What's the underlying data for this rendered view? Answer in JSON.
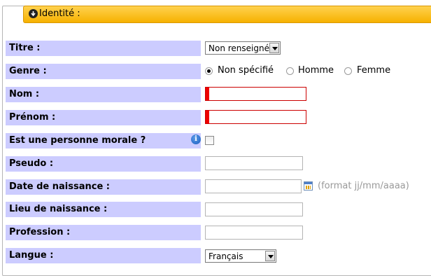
{
  "section": {
    "title": "Identité :"
  },
  "fields": {
    "titre": {
      "label": "Titre :",
      "value": "Non renseigné"
    },
    "genre": {
      "label": "Genre :",
      "options": [
        "Non spécifié",
        "Homme",
        "Femme"
      ],
      "selected": "Non spécifié"
    },
    "nom": {
      "label": "Nom :",
      "value": ""
    },
    "prenom": {
      "label": "Prénom :",
      "value": ""
    },
    "personne_morale": {
      "label": "Est une personne morale ?",
      "checked": false
    },
    "pseudo": {
      "label": "Pseudo :",
      "value": ""
    },
    "date_naissance": {
      "label": "Date de naissance :",
      "value": "",
      "hint": "(format jj/mm/aaaa)"
    },
    "lieu_naissance": {
      "label": "Lieu de naissance :",
      "value": ""
    },
    "profession": {
      "label": "Profession :",
      "value": ""
    },
    "langue": {
      "label": "Langue :",
      "value": "Français"
    }
  },
  "colors": {
    "header": "#f6b100",
    "label_bg": "#ccccff",
    "required": "#ee0000",
    "hint": "#999999"
  }
}
